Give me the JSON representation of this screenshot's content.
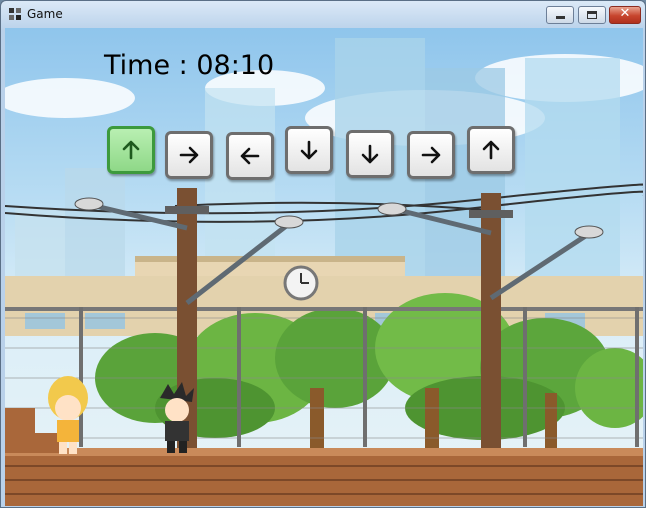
{
  "window": {
    "title": "Game"
  },
  "game": {
    "timer_text": "Time : 08:10",
    "arrow_sequence": [
      {
        "direction": "up",
        "state": "completed"
      },
      {
        "direction": "right",
        "state": "pending"
      },
      {
        "direction": "left",
        "state": "pending"
      },
      {
        "direction": "down",
        "state": "pending"
      },
      {
        "direction": "down",
        "state": "pending"
      },
      {
        "direction": "right",
        "state": "pending"
      },
      {
        "direction": "up",
        "state": "pending"
      }
    ],
    "colors": {
      "completed_key": "#8fd888",
      "pending_key": "#e3e3e3"
    }
  }
}
